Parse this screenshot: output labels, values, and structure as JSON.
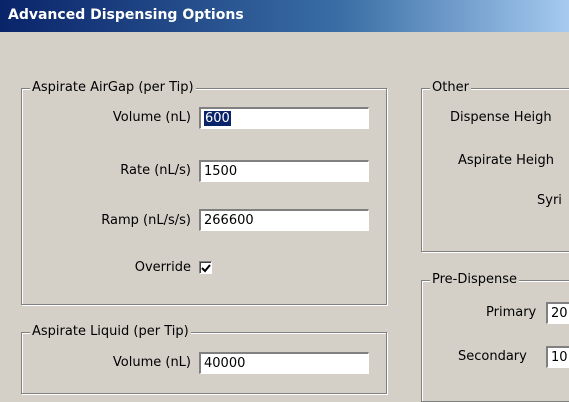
{
  "window": {
    "title": "Advanced Dispensing Options"
  },
  "aspirate_airgap": {
    "legend": "Aspirate AirGap (per Tip)",
    "volume_label": "Volume (nL)",
    "volume_value": "600",
    "rate_label": "Rate (nL/s)",
    "rate_value": "1500",
    "ramp_label": "Ramp (nL/s/s)",
    "ramp_value": "266600",
    "override_label": "Override",
    "override_checked": true
  },
  "aspirate_liquid": {
    "legend": "Aspirate Liquid (per Tip)",
    "volume_label": "Volume (nL)",
    "volume_value": "40000"
  },
  "other": {
    "legend": "Other",
    "dispense_height_label": "Dispense Heigh",
    "aspirate_height_label": "Aspirate Heigh",
    "syringe_label": "Syri"
  },
  "pre_dispense": {
    "legend": "Pre-Dispense",
    "primary_label": "Primary",
    "primary_value": "20",
    "secondary_label": "Secondary",
    "secondary_value": "10"
  }
}
